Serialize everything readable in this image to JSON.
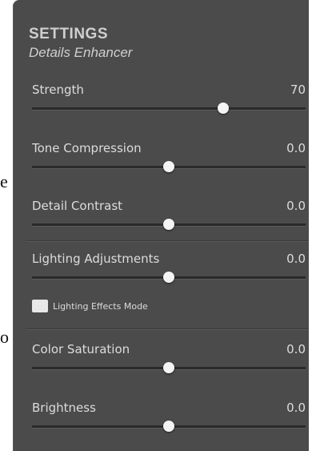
{
  "background_text": [
    "e",
    "o"
  ],
  "header": {
    "title": "SETTINGS",
    "subtitle": "Details Enhancer"
  },
  "sliders": [
    {
      "label": "Strength",
      "value": "70",
      "level_percent": 70
    },
    {
      "label": "Tone Compression",
      "value": "0.0",
      "level_percent": 50
    },
    {
      "label": "Detail Contrast",
      "value": "0.0",
      "level_percent": 50
    },
    {
      "label": "Lighting Adjustments",
      "value": "0.0",
      "level_percent": 50
    },
    {
      "label": "Color Saturation",
      "value": "0.0",
      "level_percent": 50
    },
    {
      "label": "Brightness",
      "value": "0.0",
      "level_percent": 50
    }
  ],
  "lighting_effects": {
    "label": "Lighting Effects Mode",
    "checked": false
  },
  "colors": {
    "panel_bg": "#4b4b4b",
    "text": "#dcdcdc",
    "track": "#2a2a2a",
    "thumb": "#f4f4f4"
  }
}
